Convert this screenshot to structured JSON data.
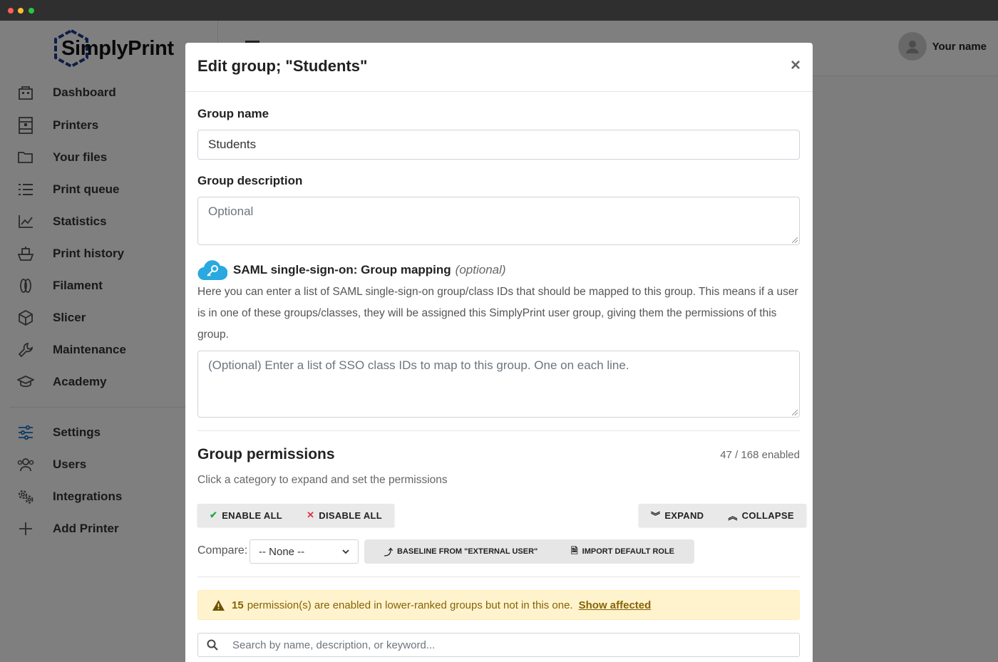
{
  "app": {
    "logo_text": "SimplyPrint",
    "user_name": "Your name"
  },
  "sidebar": {
    "items": [
      {
        "label": "Dashboard",
        "icon": "dashboard-icon"
      },
      {
        "label": "Printers",
        "icon": "printer-icon"
      },
      {
        "label": "Your files",
        "icon": "folder-icon"
      },
      {
        "label": "Print queue",
        "icon": "list-icon"
      },
      {
        "label": "Statistics",
        "icon": "chart-icon"
      },
      {
        "label": "Print history",
        "icon": "history-icon"
      },
      {
        "label": "Filament",
        "icon": "filament-icon"
      },
      {
        "label": "Slicer",
        "icon": "cube-icon"
      },
      {
        "label": "Maintenance",
        "icon": "wrench-icon"
      },
      {
        "label": "Academy",
        "icon": "graduation-cap-icon"
      },
      {
        "label": "Settings",
        "icon": "sliders-icon"
      },
      {
        "label": "Users",
        "icon": "users-icon"
      },
      {
        "label": "Integrations",
        "icon": "gears-icon"
      },
      {
        "label": "Add Printer",
        "icon": "plus-icon"
      }
    ]
  },
  "modal": {
    "title": "Edit group; \"Students\"",
    "close": "×",
    "group_name_label": "Group name",
    "group_name_value": "Students",
    "group_desc_label": "Group description",
    "group_desc_placeholder": "Optional",
    "saml_title": "SAML single-sign-on: Group mapping",
    "saml_optional": "(optional)",
    "saml_description": "Here you can enter a list of SAML single-sign-on group/class IDs that should be mapped to this group. This means if a user is in one of these groups/classes, they will be assigned this SimplyPrint user group, giving them the permissions of this group.",
    "saml_placeholder": "(Optional) Enter a list of SSO class IDs to map to this group. One on each line.",
    "permissions_title": "Group permissions",
    "permissions_count": "47 / 168 enabled",
    "permissions_hint": "Click a category to expand and set the permissions",
    "enable_all": "ENABLE ALL",
    "disable_all": "DISABLE ALL",
    "expand": "EXPAND",
    "collapse": "COLLAPSE",
    "compare_label": "Compare:",
    "compare_value": "-- None --",
    "baseline_btn": "BASELINE FROM \"EXTERNAL USER\"",
    "import_btn": "IMPORT DEFAULT ROLE",
    "alert_count": "15",
    "alert_text": "permission(s) are enabled in lower-ranked groups but not in this one.",
    "alert_link": "Show affected",
    "search_placeholder": "Search by name, description, or keyword..."
  },
  "colors": {
    "accent": "#1a73c8",
    "saml_icon": "#29a9e0",
    "enable_green": "#28a745",
    "disable_red": "#dc3545",
    "alert_bg": "#fff3cd"
  }
}
